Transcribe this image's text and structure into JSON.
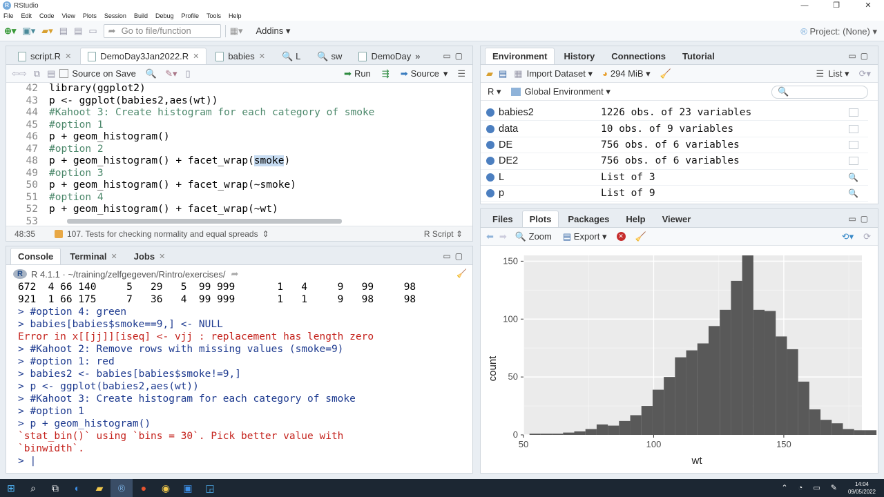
{
  "window": {
    "title": "RStudio",
    "controls": [
      "—",
      "❐",
      "✕"
    ]
  },
  "menu": [
    "File",
    "Edit",
    "Code",
    "View",
    "Plots",
    "Session",
    "Build",
    "Debug",
    "Profile",
    "Tools",
    "Help"
  ],
  "toolbar": {
    "goto_placeholder": "Go to file/function",
    "addins": "Addins",
    "project": "Project: (None)"
  },
  "source": {
    "tabs": [
      "script.R",
      "DemoDay3Jan2022.R",
      "babies",
      "L",
      "sw",
      "DemoDay"
    ],
    "source_on_save": "Source on Save",
    "run": "Run",
    "source": "Source",
    "lines": [
      {
        "n": "42",
        "t": "library(ggplot2)",
        "k": "code"
      },
      {
        "n": "43",
        "t": "p <- ggplot(babies2,aes(wt))",
        "k": "code"
      },
      {
        "n": "44",
        "t": "#Kahoot 3: Create histogram for each category of smoke",
        "k": "com"
      },
      {
        "n": "45",
        "t": "#option 1",
        "k": "com"
      },
      {
        "n": "46",
        "t": "p + geom_histogram()",
        "k": "code"
      },
      {
        "n": "47",
        "t": "#option 2",
        "k": "com"
      },
      {
        "n": "48",
        "t": "p + geom_histogram() + facet_wrap(smoke)",
        "k": "code"
      },
      {
        "n": "49",
        "t": "#option 3",
        "k": "com"
      },
      {
        "n": "50",
        "t": "p + geom_histogram() + facet_wrap(~smoke)",
        "k": "code"
      },
      {
        "n": "51",
        "t": "#option 4",
        "k": "com"
      },
      {
        "n": "52",
        "t": "p + geom_histogram() + facet_wrap(~wt)",
        "k": "code"
      },
      {
        "n": "53",
        "t": "",
        "k": "code"
      }
    ],
    "status_pos": "48:35",
    "status_section": "107. Tests for checking normality and equal spreads",
    "status_type": "R Script"
  },
  "console": {
    "tabs": [
      "Console",
      "Terminal",
      "Jobs"
    ],
    "path": "R 4.1.1 · ~/training/zelfgegeven/Rintro/exercises/",
    "lines": [
      {
        "t": "672  4 66 140     5   29   5  99 999       1   4     9   99     98",
        "k": "out"
      },
      {
        "t": "921  1 66 175     7   36   4  99 999       1   1     9   98     98",
        "k": "out"
      },
      {
        "t": "> #option 4: green",
        "k": "in"
      },
      {
        "t": "> babies[babies$smoke==9,] <- NULL",
        "k": "in"
      },
      {
        "t": "Error in x[[jj]][iseq] <- vjj : replacement has length zero",
        "k": "err"
      },
      {
        "t": "> #Kahoot 2: Remove rows with missing values (smoke=9)",
        "k": "in"
      },
      {
        "t": "> #option 1: red",
        "k": "in"
      },
      {
        "t": "> babies2 <- babies[babies$smoke!=9,]",
        "k": "in"
      },
      {
        "t": "> p <- ggplot(babies2,aes(wt))",
        "k": "in"
      },
      {
        "t": "> #Kahoot 3: Create histogram for each category of smoke",
        "k": "in"
      },
      {
        "t": "> #option 1",
        "k": "in"
      },
      {
        "t": "> p + geom_histogram()",
        "k": "in"
      },
      {
        "t": "`stat_bin()` using `bins = 30`. Pick better value with",
        "k": "err"
      },
      {
        "t": "`binwidth`.",
        "k": "err"
      },
      {
        "t": "> |",
        "k": "in"
      }
    ]
  },
  "environment": {
    "tabs": [
      "Environment",
      "History",
      "Connections",
      "Tutorial"
    ],
    "import": "Import Dataset",
    "memory": "294 MiB",
    "view": "List",
    "lang": "R",
    "scope": "Global Environment",
    "rows": [
      {
        "name": "babies2",
        "value": "1226 obs. of 23 variables",
        "icon": "grid"
      },
      {
        "name": "data",
        "value": "10 obs. of 9 variables",
        "icon": "grid"
      },
      {
        "name": "DE",
        "value": "756 obs. of 6 variables",
        "icon": "grid"
      },
      {
        "name": "DE2",
        "value": "756 obs. of 6 variables",
        "icon": "grid"
      },
      {
        "name": "L",
        "value": "List of  3",
        "icon": "search"
      },
      {
        "name": "p",
        "value": "List of  9",
        "icon": "search"
      }
    ]
  },
  "plots": {
    "tabs": [
      "Files",
      "Plots",
      "Packages",
      "Help",
      "Viewer"
    ],
    "zoom": "Zoom",
    "export": "Export"
  },
  "chart_data": {
    "type": "bar",
    "xlabel": "wt",
    "ylabel": "count",
    "xlim": [
      50,
      180
    ],
    "ylim": [
      0,
      155
    ],
    "xticks": [
      50,
      100,
      150
    ],
    "yticks": [
      0,
      50,
      100,
      150
    ],
    "bin_start": 52.3,
    "bin_width": 4.3,
    "values": [
      1,
      1,
      1,
      2,
      3,
      5,
      9,
      8,
      12,
      17,
      25,
      39,
      50,
      67,
      73,
      79,
      94,
      108,
      133,
      155,
      108,
      107,
      85,
      74,
      46,
      22,
      13,
      10,
      5,
      4,
      4
    ]
  },
  "taskbar": {
    "time": "14:04",
    "date": "09/05/2022"
  }
}
